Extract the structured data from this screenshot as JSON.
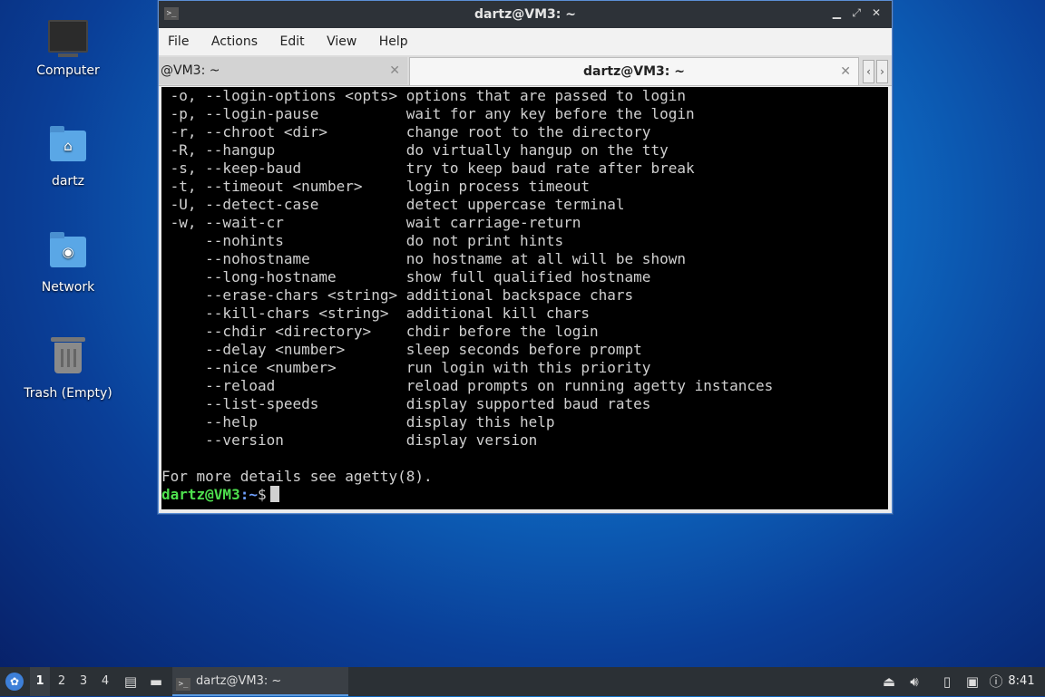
{
  "desktop": {
    "icons": [
      {
        "label": "Computer"
      },
      {
        "label": "dartz"
      },
      {
        "label": "Network"
      },
      {
        "label": "Trash (Empty)"
      }
    ]
  },
  "window": {
    "title": "dartz@VM3: ~",
    "controls": {
      "minimize": "▁",
      "maximize": "⤢",
      "close": "✕"
    }
  },
  "menu": [
    "File",
    "Actions",
    "Edit",
    "View",
    "Help"
  ],
  "tabs": [
    {
      "label": "@VM3: ~",
      "close": "✕"
    },
    {
      "label": "dartz@VM3: ~",
      "close": "✕"
    }
  ],
  "tab_scroll": {
    "left": "‹",
    "right": "›"
  },
  "terminal": {
    "lines": [
      " -o, --login-options <opts> options that are passed to login",
      " -p, --login-pause          wait for any key before the login",
      " -r, --chroot <dir>         change root to the directory",
      " -R, --hangup               do virtually hangup on the tty",
      " -s, --keep-baud            try to keep baud rate after break",
      " -t, --timeout <number>     login process timeout",
      " -U, --detect-case          detect uppercase terminal",
      " -w, --wait-cr              wait carriage-return",
      "     --nohints              do not print hints",
      "     --nohostname           no hostname at all will be shown",
      "     --long-hostname        show full qualified hostname",
      "     --erase-chars <string> additional backspace chars",
      "     --kill-chars <string>  additional kill chars",
      "     --chdir <directory>    chdir before the login",
      "     --delay <number>       sleep seconds before prompt",
      "     --nice <number>        run login with this priority",
      "     --reload               reload prompts on running agetty instances",
      "     --list-speeds          display supported baud rates",
      "     --help                 display this help",
      "     --version              display version",
      "",
      "For more details see agetty(8)."
    ],
    "prompt_user": "dartz@VM3",
    "prompt_sep": ":",
    "prompt_path": "~",
    "prompt_symbol": "$"
  },
  "taskbar": {
    "workspaces": [
      "1",
      "2",
      "3",
      "4"
    ],
    "active_workspace": "1",
    "task_label": "dartz@VM3: ~",
    "clock": "8:41"
  }
}
